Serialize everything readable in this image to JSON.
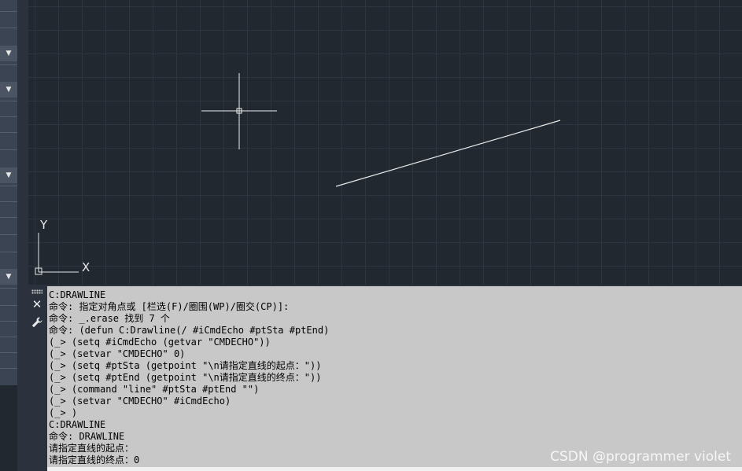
{
  "left_panel": {
    "arrow_glyph": "▼"
  },
  "canvas": {
    "ucs_x_label": "X",
    "ucs_y_label": "Y"
  },
  "command_line": {
    "close_icon": "close-icon",
    "customize_icon": "wrench-icon",
    "history": [
      "C:DRAWLINE",
      "命令: 指定对角点或 [栏选(F)/圈围(WP)/圈交(CP)]:",
      "命令: _.erase 找到 7 个",
      "命令: (defun C:Drawline(/ #iCmdEcho #ptSta #ptEnd)",
      "(_> (setq #iCmdEcho (getvar \"CMDECHO\"))",
      "(_> (setvar \"CMDECHO\" 0)",
      "(_> (setq #ptSta (getpoint \"\\n请指定直线的起点：\"))",
      "(_> (setq #ptEnd (getpoint \"\\n请指定直线的终点：\"))",
      "(_> (command \"line\" #ptSta #ptEnd \"\")",
      "(_> (setvar \"CMDECHO\" #iCmdEcho)",
      "(_> )",
      "C:DRAWLINE",
      "命令: DRAWLINE",
      "请指定直线的起点：",
      "请指定直线的终点：0"
    ]
  },
  "watermark": "CSDN @programmer violet",
  "colors": {
    "canvas_bg": "#212830",
    "grid": "#2d3542",
    "command_bg": "#c8c8c8",
    "line": "#e8e8e8"
  }
}
